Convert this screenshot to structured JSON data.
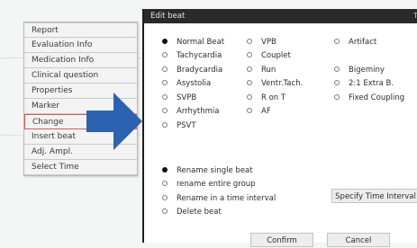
{
  "context_menu": {
    "items": [
      {
        "label": "Report"
      },
      {
        "label": "Evaluation Info"
      },
      {
        "label": "Medication Info"
      },
      {
        "label": "Clinical question"
      },
      {
        "label": "Properties"
      },
      {
        "label": "Marker"
      },
      {
        "label": "Change",
        "highlighted": true
      },
      {
        "label": "Insert beat"
      },
      {
        "label": "Adj. Ampl."
      },
      {
        "label": "Select Time"
      }
    ]
  },
  "dialog": {
    "title": "Edit beat",
    "close_glyph": "T",
    "beat_types": {
      "selected": "Normal Beat",
      "col1": [
        "Normal Beat",
        "Tachycardia",
        "Bradycardia",
        "Asystolia",
        "SVPB",
        "Arrhythmia",
        "PSVT"
      ],
      "col2": [
        "VPB",
        "Couplet",
        "Run",
        "Ventr.Tach.",
        "R on T",
        "AF"
      ],
      "col3": [
        "Artifact",
        "",
        "Bigeminy",
        "2:1 Extra B.",
        "Fixed Coupling"
      ]
    },
    "rename_options": {
      "selected": "Rename single beat",
      "items": [
        "Rename single beat",
        "rename entire group",
        "Rename in a time interval",
        "Delete beat"
      ]
    },
    "specify_time_button": "Specify Time Interval",
    "confirm_button": "Confirm",
    "cancel_button": "Cancel"
  },
  "colors": {
    "arrow": "#2d62b0",
    "titlebar": "#2a2a2a",
    "highlight_border": "#d25a5a"
  },
  "icons": {
    "arrow": "right-arrow-icon",
    "radio": "radio-icon"
  }
}
